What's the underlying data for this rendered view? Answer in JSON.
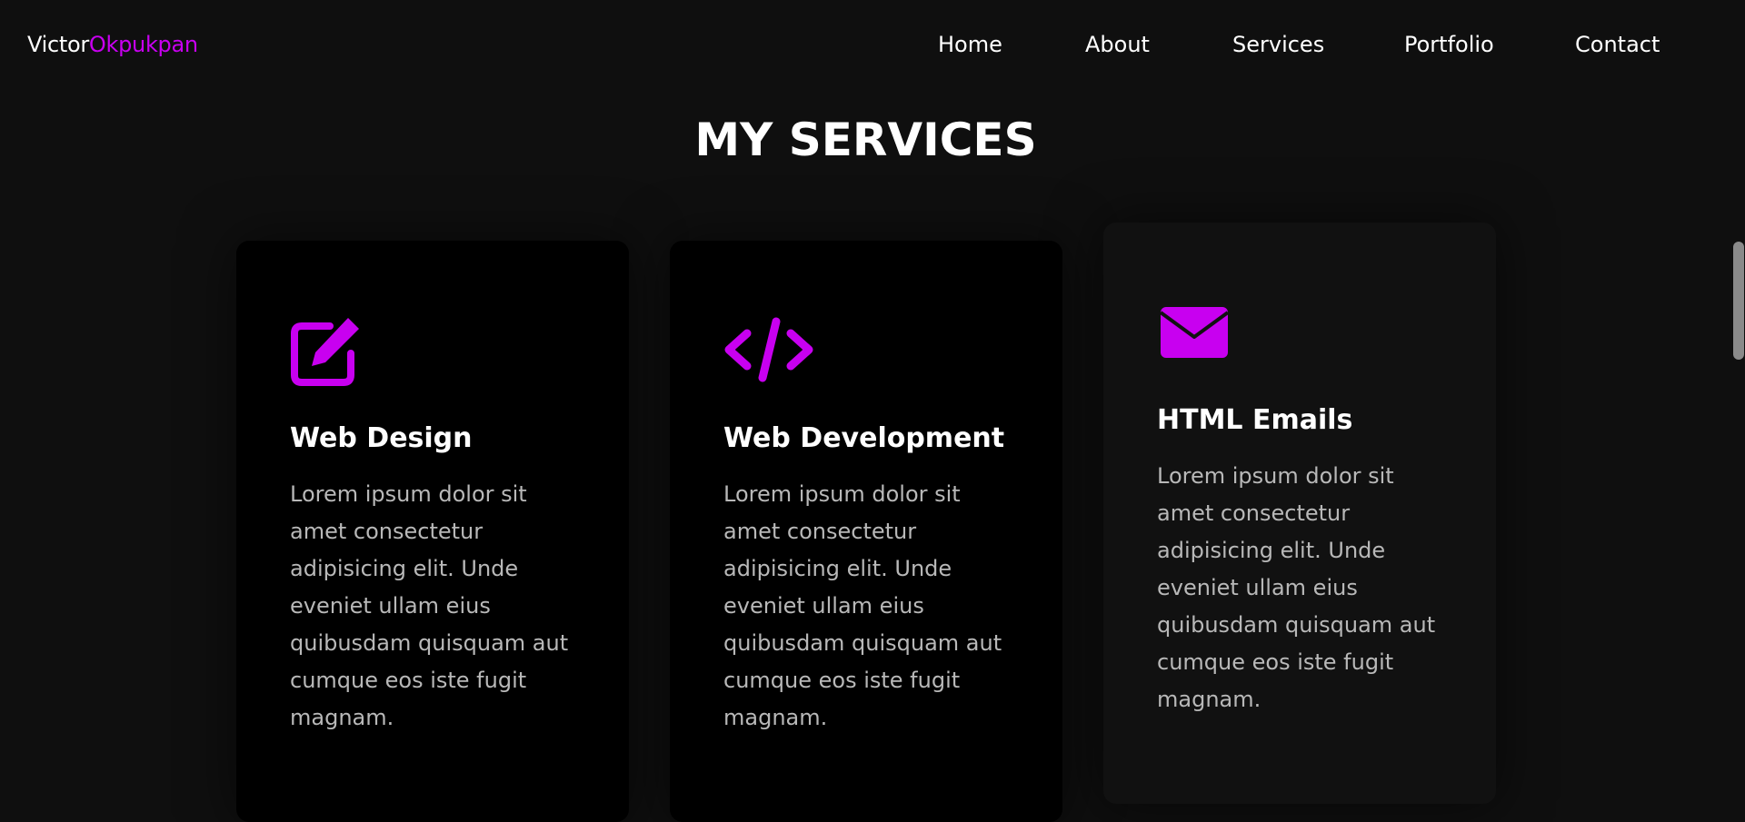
{
  "nav": {
    "logo_first": "Victor",
    "logo_accent": "Okpukpan",
    "links": [
      {
        "label": "Home"
      },
      {
        "label": "About"
      },
      {
        "label": "Services"
      },
      {
        "label": "Portfolio"
      },
      {
        "label": "Contact"
      }
    ]
  },
  "section": {
    "title": "MY SERVICES"
  },
  "services": [
    {
      "icon": "edit-icon",
      "title": "Web Design",
      "description": "Lorem ipsum dolor sit amet consectetur adipisicing elit. Unde eveniet ullam eius quibusdam quisquam aut cumque eos iste fugit magnam."
    },
    {
      "icon": "code-icon",
      "title": "Web Development",
      "description": "Lorem ipsum dolor sit amet consectetur adipisicing elit. Unde eveniet ullam eius quibusdam quisquam aut cumque eos iste fugit magnam."
    },
    {
      "icon": "envelope-icon",
      "title": "HTML Emails",
      "description": "Lorem ipsum dolor sit amet consectetur adipisicing elit. Unde eveniet ullam eius quibusdam quisquam aut cumque eos iste fugit magnam."
    }
  ],
  "colors": {
    "accent": "#c800f0",
    "background": "#0f0f0f",
    "card_background": "#000000",
    "card_background_hovered": "#111111",
    "text_primary": "#ffffff",
    "text_muted": "#b8b8b8"
  }
}
